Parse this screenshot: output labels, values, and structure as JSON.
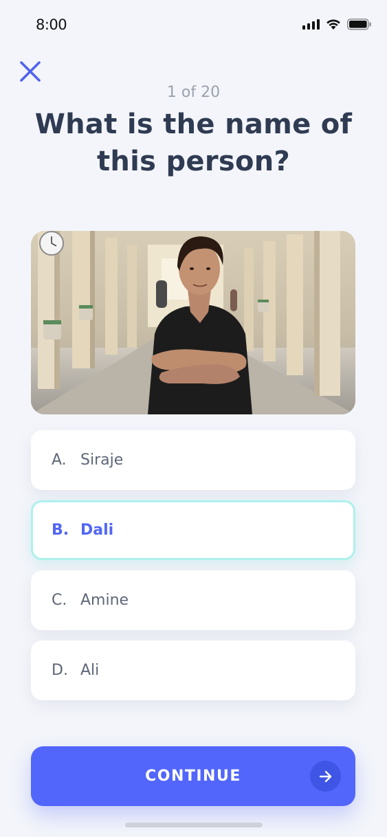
{
  "status_bar": {
    "time": "8:00",
    "icons": [
      "signal-icon",
      "wifi-icon",
      "battery-icon"
    ]
  },
  "header": {
    "close_icon": "close-icon",
    "progress_text": "1 of 20",
    "question": "What is the name of this person?"
  },
  "photo": {
    "subject": "person-photo"
  },
  "options": [
    {
      "letter": "A.",
      "name": "Siraje",
      "selected": false
    },
    {
      "letter": "B.",
      "name": "Dali",
      "selected": true
    },
    {
      "letter": "C.",
      "name": "Amine",
      "selected": false
    },
    {
      "letter": "D.",
      "name": "Ali",
      "selected": false
    }
  ],
  "footer": {
    "continue_label": "CONTINUE",
    "arrow_icon": "arrow-right-icon"
  },
  "colors": {
    "accent": "#5266fb",
    "selected_border": "#aef0ec",
    "background": "#f3f5fa",
    "title": "#2f3b52"
  }
}
